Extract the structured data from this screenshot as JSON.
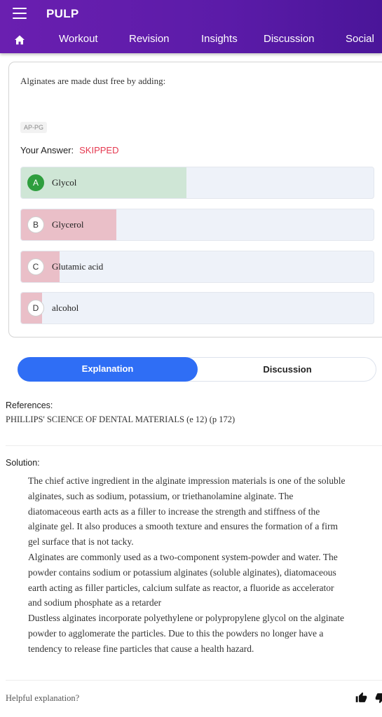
{
  "app": {
    "title": "PULP"
  },
  "nav": {
    "home_icon": "home-icon",
    "items": [
      "Workout",
      "Revision",
      "Insights",
      "Discussion",
      "Social"
    ]
  },
  "question": {
    "text": "Alginates are made dust free by adding:",
    "tag": "AP-PG",
    "your_answer_label": "Your Answer:",
    "your_answer_value": "SKIPPED",
    "options": [
      {
        "letter": "A",
        "text": "Glycol",
        "percent": 47,
        "correct": true
      },
      {
        "letter": "B",
        "text": "Glycerol",
        "percent": 27,
        "correct": false
      },
      {
        "letter": "C",
        "text": "Glutamic acid",
        "percent": 11,
        "correct": false
      },
      {
        "letter": "D",
        "text": "alcohol",
        "percent": 6,
        "correct": false
      }
    ]
  },
  "tabs": {
    "explanation": "Explanation",
    "discussion": "Discussion"
  },
  "references": {
    "label": "References:",
    "text": "PHILLIPS' SCIENCE OF DENTAL MATERIALS (e 12) (p 172)"
  },
  "solution": {
    "label": "Solution:",
    "lines": [
      "The chief active ingredient in the alginate impression materials is one of the soluble",
      "alginates, such as sodium, potassium, or triethanolamine alginate. The",
      "diatomaceous earth acts as a filler to increase the strength and stiffness of the",
      "alginate gel. It also produces a smooth texture and ensures the formation of a firm",
      "gel surface that is not tacky.",
      "Alginates are commonly used as a two-component system-powder and water. The",
      "powder contains sodium or potassium alginates (soluble alginates), diatomaceous",
      "earth acting as filler particles, calcium sulfate as reactor, a fluoride as accelerator",
      "and sodium phosphate as a retarder",
      "Dustless alginates incorporate polyethylene or polypropylene glycol on the alginate",
      "powder to agglomerate the particles. Due to this the powders no longer have a",
      "tendency to release fine particles that cause a health hazard."
    ]
  },
  "footer": {
    "helpful_text": "Helpful explanation?",
    "like_icon": "thumbs-up-icon",
    "dislike_icon": "thumbs-down-icon"
  },
  "colors": {
    "appbar": "#5b1ba8",
    "accent": "#2f6ef5",
    "correct_fill": "#cfe6d6",
    "wrong_fill": "#eabfc8",
    "correct_badge": "#2e9e3e",
    "skipped": "#e53950"
  }
}
